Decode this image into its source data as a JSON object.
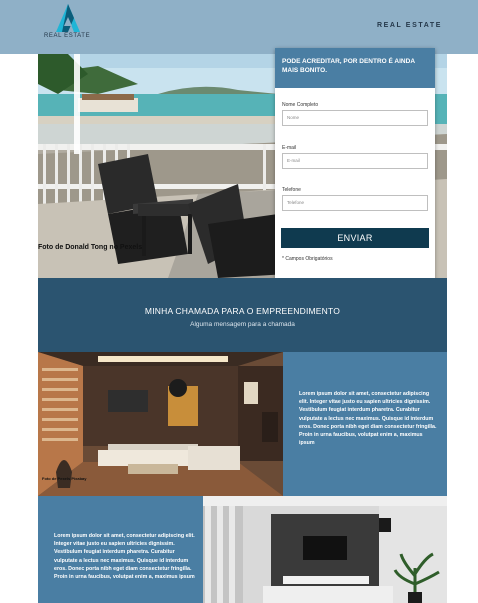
{
  "header": {
    "logo_text": "REAL ESTATE",
    "brand_text": "REAL ESTATE"
  },
  "hero": {
    "photo_credit": "Foto de Donald Tong no Pexels"
  },
  "form": {
    "title": "PODE ACREDITAR, POR DENTRO É AINDA MAIS BONITO.",
    "name_label": "Nome Completo",
    "name_placeholder": "Nome",
    "email_label": "E-mail",
    "email_placeholder": "E-mail",
    "phone_label": "Telefone",
    "phone_placeholder": "Telefone",
    "submit_label": "ENVIAR",
    "required_note": "* Campos Obrigatórios"
  },
  "cta": {
    "title": "MINHA CHAMADA PARA O EMPREENDIMENTO",
    "subtitle": "Alguma mensagem para a chamada"
  },
  "features": [
    {
      "photo_credit": "Foto de Pexels Pixabay",
      "text": "Lorem ipsum dolor sit amet, consectetur adipiscing elit. Integer vitae justo eu sapien ultricies dignissim. Vestibulum feugiat interdum pharetra. Curabitur vulputate a lectus nec maximus. Quisque id interdum eros. Donec porta nibh eget diam consectetur fringilla. Proin in urna faucibus, volutpat enim a, maximus ipsum"
    },
    {
      "text": "Lorem ipsum dolor sit amet, consectetur adipiscing elit. Integer vitae justo eu sapien ultricies dignissim. Vestibulum feugiat interdum pharetra. Curabitur vulputate a lectus nec maximus. Quisque id interdum eros. Donec porta nibh eget diam consectetur fringilla. Proin in urna faucibus, volutpat enim a, maximus ipsum"
    }
  ],
  "colors": {
    "header_bg": "#8fb0c7",
    "form_header": "#4a7ea3",
    "cta_band": "#2b5470",
    "button": "#0f3a4f",
    "text_panel": "#4a7ea3"
  }
}
